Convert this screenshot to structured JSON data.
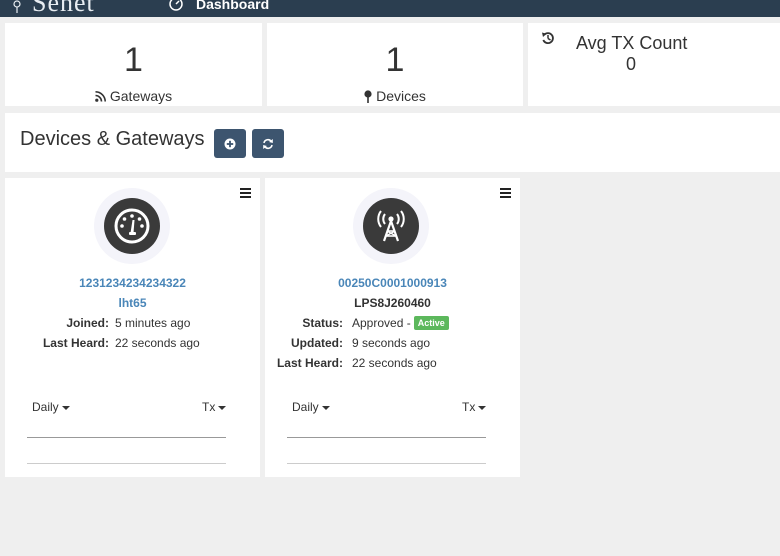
{
  "topbar": {
    "brand": "Senet",
    "nav_dashboard": "Dashboard"
  },
  "stats": {
    "gateways": {
      "count": "1",
      "label": "Gateways"
    },
    "devices": {
      "count": "1",
      "label": "Devices"
    },
    "avg_tx": {
      "label": "Avg TX Count",
      "value": "0"
    }
  },
  "section": {
    "title": "Devices & Gateways"
  },
  "device_card": {
    "id": "1231234234234322",
    "name": "lht65",
    "fields": [
      {
        "label": "Joined:",
        "value": "5 minutes ago"
      },
      {
        "label": "Last Heard:",
        "value": "22 seconds ago"
      }
    ],
    "period": "Daily",
    "metric": "Tx"
  },
  "gateway_card": {
    "id": "00250C0001000913",
    "name": "LPS8J260460",
    "status_label": "Status:",
    "status_value": "Approved -",
    "status_badge": "Active",
    "fields": [
      {
        "label": "Updated:",
        "value": "9 seconds ago"
      },
      {
        "label": "Last Heard:",
        "value": "22 seconds ago"
      }
    ],
    "period": "Daily",
    "metric": "Tx"
  },
  "colors": {
    "topbar": "#2b3e50",
    "button": "#3d556f",
    "link": "#4a86b8",
    "active_badge": "#5cb85c"
  }
}
